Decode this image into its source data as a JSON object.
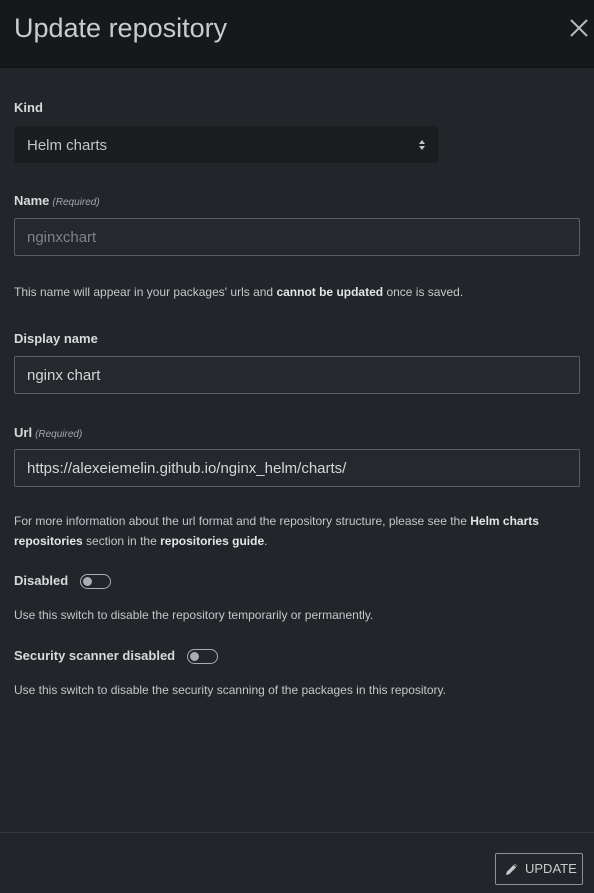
{
  "modal": {
    "title": "Update repository"
  },
  "kind": {
    "label": "Kind",
    "selected": "Helm charts"
  },
  "name": {
    "label": "Name",
    "required": "(Required)",
    "value": "nginxchart",
    "help_1": "This name will appear in your packages' urls and ",
    "help_bold": "cannot be updated",
    "help_2": " once is saved."
  },
  "display_name": {
    "label": "Display name",
    "value": "nginx chart"
  },
  "url": {
    "label": "Url",
    "required": "(Required)",
    "value": "https://alexeiemelin.github.io/nginx_helm/charts/",
    "help_1": "For more information about the url format and the repository structure, please see the ",
    "help_bold_1": "Helm charts repositories",
    "help_2": " section in the ",
    "help_bold_2": "repositories guide",
    "help_3": "."
  },
  "disabled": {
    "label": "Disabled",
    "help": "Use this switch to disable the repository temporarily or permanently."
  },
  "scanner": {
    "label": "Security scanner disabled",
    "help": "Use this switch to disable the security scanning of the packages in this repository."
  },
  "footer": {
    "update_label": "UPDATE"
  },
  "icons": {
    "close": "close-icon",
    "select_arrow": "select-arrows-icon",
    "update": "pencil-icon"
  }
}
